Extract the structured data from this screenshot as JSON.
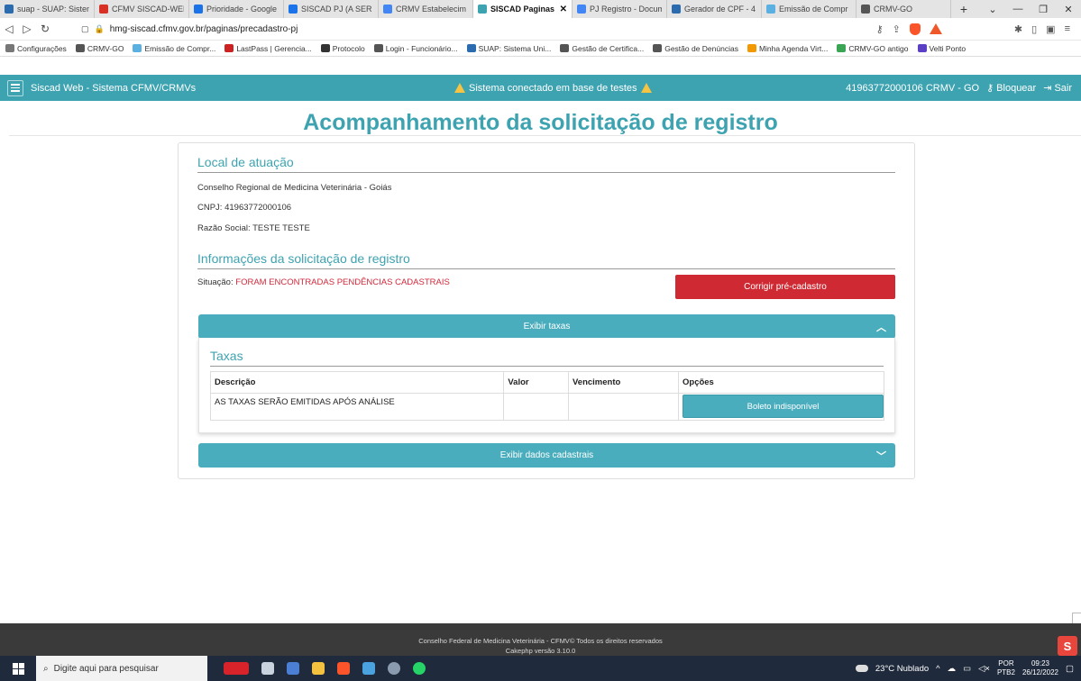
{
  "browser": {
    "tabs": [
      {
        "title": "suap - SUAP: Sistema Un",
        "color": "#2b6cb0",
        "active": false
      },
      {
        "title": "CFMV SISCAD-WEB",
        "color": "#d93025",
        "active": false
      },
      {
        "title": "Prioridade - Google",
        "color": "#1a73e8",
        "active": false
      },
      {
        "title": "SISCAD PJ (A SER C",
        "color": "#1a73e8",
        "active": false
      },
      {
        "title": "CRMV Estabelecim",
        "color": "#4285f4",
        "active": false
      },
      {
        "title": "SISCAD Paginas",
        "color": "#3ea3b1",
        "active": true
      },
      {
        "title": "PJ Registro - Docum",
        "color": "#4285f4",
        "active": false
      },
      {
        "title": "Gerador de CPF - 4",
        "color": "#2b6cb0",
        "active": false
      },
      {
        "title": "Emissão de Compr",
        "color": "#5ab0e0",
        "active": false
      },
      {
        "title": "CRMV-GO",
        "color": "#555555",
        "active": false
      }
    ],
    "new_tab": "+",
    "url": "hmg-siscad.cfmv.gov.br/paginas/precadastro-pj",
    "bookmarks": [
      {
        "label": "Configurações",
        "color": "#777777"
      },
      {
        "label": "CRMV-GO",
        "color": "#555555"
      },
      {
        "label": "Emissão de Compr...",
        "color": "#5ab0e0"
      },
      {
        "label": "LastPass | Gerencia...",
        "color": "#cc2222"
      },
      {
        "label": "Protocolo",
        "color": "#333333"
      },
      {
        "label": "Login - Funcionário...",
        "color": "#555555"
      },
      {
        "label": "SUAP: Sistema Uni...",
        "color": "#2b6cb0"
      },
      {
        "label": "Gestão de Certifica...",
        "color": "#555555"
      },
      {
        "label": "Gestão de Denúncias",
        "color": "#555555"
      },
      {
        "label": "Minha Agenda Virt...",
        "color": "#f29900"
      },
      {
        "label": "CRMV-GO antigo",
        "color": "#3aa655"
      },
      {
        "label": "Velti Ponto",
        "color": "#5b3fc4"
      }
    ]
  },
  "nav": {
    "brand": "Siscad Web - Sistema CFMV/CRMVs",
    "test_notice": "Sistema conectado em base de testes",
    "user": "41963772000106 CRMV - GO",
    "lock_label": "Bloquear",
    "logout_label": "Sair"
  },
  "page": {
    "title": "Acompanhamento da solicitação de registro"
  },
  "local": {
    "heading": "Local de atuação",
    "council": "Conselho Regional de Medicina Veterinária - Goiás",
    "cnpj_label": "CNPJ:",
    "cnpj": "41963772000106",
    "razao_label": "Razão Social:",
    "razao": "TESTE TESTE"
  },
  "solicitacao": {
    "heading": "Informações da solicitação de registro",
    "status_label": "Situação:",
    "status": "FORAM ENCONTRADAS PENDÊNCIAS CADASTRAIS",
    "fix_button": "Corrigir pré-cadastro"
  },
  "taxas": {
    "toggle_label": "Exibir taxas",
    "heading": "Taxas",
    "columns": [
      "Descrição",
      "Valor",
      "Vencimento",
      "Opções"
    ],
    "rows": [
      {
        "descricao": "AS TAXAS SERÃO EMITIDAS APÓS ANÁLISE",
        "valor": "",
        "vencimento": "",
        "opcao": "Boleto indisponível"
      }
    ]
  },
  "dados": {
    "toggle_label": "Exibir dados cadastrais"
  },
  "footer": {
    "line1": "Conselho Federal de Medicina Veterinária - CFMV© Todos os direitos reservados",
    "line2": "Cakephp versão 3.10.0"
  },
  "taskbar": {
    "search_placeholder": "Digite aqui para pesquisar",
    "weather": "23°C  Nublado",
    "lang": "POR",
    "lang2": "PTB2",
    "time": "09:23",
    "date": "26/12/2022"
  },
  "colors": {
    "primary": "#3ea3b1",
    "danger": "#cf2a33"
  }
}
